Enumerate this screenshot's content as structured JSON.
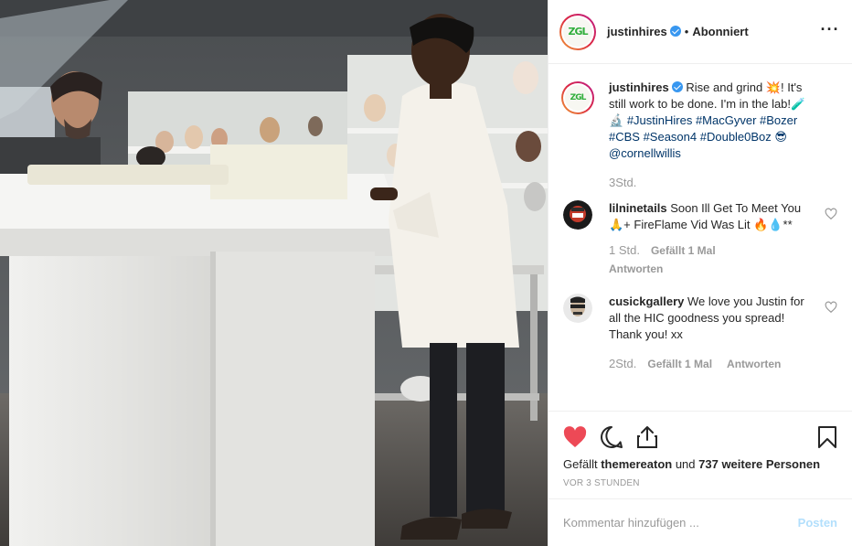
{
  "post": {
    "username": "justinhires",
    "follow_status": "Abonniert",
    "separator": "•",
    "more_icon": "more-horizontal-icon",
    "avatar_text": "ZGL"
  },
  "caption": {
    "username": "justinhires",
    "text_before": "Rise and grind 💥! It's still work to be done. I'm in the lab!🧪🔬",
    "hashtags": "#JustinHires #MacGyver #Bozer #CBS #Season4 #Double0Boz 😎",
    "mention": "@cornellwillis",
    "time": "3Std."
  },
  "comments": [
    {
      "username": "lilninetails",
      "text": "Soon Ill Get To Meet You 🙏+ FireFlame Vid Was Lit 🔥💧**",
      "time": "1 Std.",
      "likes": "Gefällt 1 Mal",
      "reply": "Antworten"
    },
    {
      "username": "cusickgallery",
      "text": "We love you Justin for all the HIC goodness you spread! Thank you! xx",
      "time": "2Std.",
      "likes": "Gefällt 1 Mal",
      "reply": "Antworten"
    }
  ],
  "actions": {
    "likes_prefix": "Gefällt ",
    "likes_user": "themereaton",
    "likes_mid": " und ",
    "likes_count": "737 weitere Personen",
    "time_ago": "VOR 3 STUNDEN"
  },
  "comment_form": {
    "placeholder": "Kommentar hinzufügen ...",
    "post_label": "Posten"
  },
  "colors": {
    "heart": "#ed4956",
    "link": "#003569",
    "verified": "#3897f0",
    "muted": "#999999",
    "post_disabled": "#b2dffc"
  }
}
